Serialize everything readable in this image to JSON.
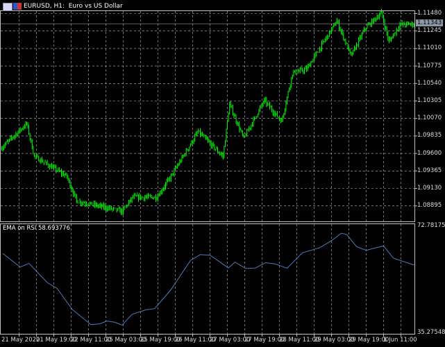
{
  "title": "EURUSD, H1:  Euro vs US Dollar",
  "colors": {
    "candle": "#00ff00",
    "grid": "#c0c0c0",
    "frame": "#c0c0c0",
    "rsi_line": "#4a7fb8",
    "price_label_bg": "#8a97a6"
  },
  "icons": [
    "chart-window-icon",
    "symbol-flag-icon"
  ],
  "price_axis": [
    "1.11480",
    "1.11245",
    "1.11010",
    "1.10775",
    "1.10540",
    "1.10305",
    "1.10070",
    "1.09835",
    "1.09600",
    "1.09365",
    "1.09130",
    "1.08895"
  ],
  "current_price": "1.11343",
  "indicator": {
    "label": "EMA on RSI 58.693776",
    "max": "72.781759",
    "min": "35.275487"
  },
  "time_axis": [
    "21 May 2020",
    "21 May 19:00",
    "22 May 11:00",
    "25 May 03:00",
    "25 May 19:00",
    "26 May 11:00",
    "27 May 03:00",
    "27 May 19:00",
    "28 May 11:00",
    "29 May 03:00",
    "29 May 19:00",
    "1 Jun 11:00"
  ],
  "chart_data": [
    {
      "type": "candlestick",
      "symbol": "EURUSD",
      "timeframe": "H1",
      "ylim": [
        1.0878,
        1.116
      ],
      "bars": 381,
      "approx_close_path": [
        [
          2,
          1.0969
        ],
        [
          24,
          1.1
        ],
        [
          31,
          1.0956
        ],
        [
          61,
          1.0929
        ],
        [
          70,
          1.0896
        ],
        [
          112,
          1.0882
        ],
        [
          122,
          1.0901
        ],
        [
          144,
          1.0901
        ],
        [
          157,
          1.0929
        ],
        [
          182,
          1.0989
        ],
        [
          205,
          1.0956
        ],
        [
          211,
          1.1026
        ],
        [
          224,
          1.098
        ],
        [
          243,
          1.1031
        ],
        [
          259,
          1.1003
        ],
        [
          269,
          1.1068
        ],
        [
          282,
          1.1073
        ],
        [
          310,
          1.1138
        ],
        [
          323,
          1.1091
        ],
        [
          336,
          1.1128
        ],
        [
          351,
          1.1149
        ],
        [
          358,
          1.111
        ],
        [
          368,
          1.1133
        ],
        [
          381,
          1.1134
        ]
      ]
    },
    {
      "type": "line",
      "name": "EMA on RSI",
      "ylim": [
        35.275487,
        72.781759
      ],
      "points": [
        [
          2,
          63.1
        ],
        [
          18,
          58.4
        ],
        [
          26,
          59.7
        ],
        [
          43,
          53.0
        ],
        [
          52,
          51.0
        ],
        [
          66,
          43.7
        ],
        [
          83,
          38.5
        ],
        [
          91,
          38.7
        ],
        [
          98,
          39.7
        ],
        [
          105,
          39.3
        ],
        [
          112,
          38.3
        ],
        [
          121,
          42.0
        ],
        [
          134,
          43.6
        ],
        [
          142,
          44.0
        ],
        [
          157,
          50.6
        ],
        [
          175,
          60.7
        ],
        [
          184,
          62.7
        ],
        [
          193,
          62.5
        ],
        [
          210,
          58.1
        ],
        [
          216,
          60.1
        ],
        [
          226,
          57.9
        ],
        [
          235,
          58.1
        ],
        [
          244,
          59.9
        ],
        [
          253,
          59.5
        ],
        [
          264,
          58.0
        ],
        [
          278,
          63.3
        ],
        [
          294,
          65.1
        ],
        [
          304,
          67.3
        ],
        [
          314,
          70.1
        ],
        [
          319,
          69.7
        ],
        [
          328,
          65.5
        ],
        [
          337,
          64.2
        ],
        [
          344,
          64.9
        ],
        [
          353,
          65.7
        ],
        [
          362,
          61.5
        ],
        [
          381,
          59.1
        ]
      ]
    }
  ]
}
